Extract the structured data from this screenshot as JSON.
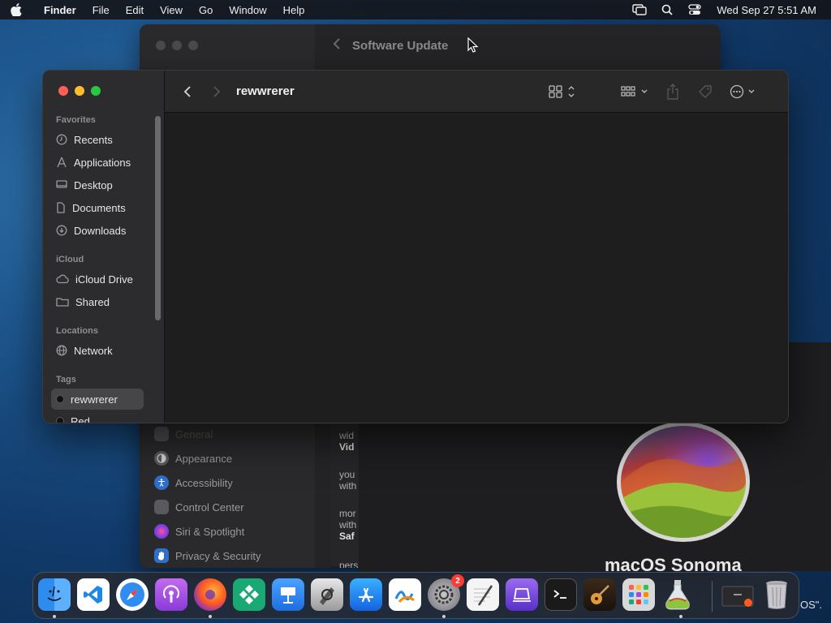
{
  "menubar": {
    "app_name": "Finder",
    "menus": [
      "File",
      "Edit",
      "View",
      "Go",
      "Window",
      "Help"
    ],
    "clock": "Wed Sep 27  5:51 AM",
    "tray_icons": [
      "screen-mirroring-icon",
      "spotlight-search-icon",
      "control-center-icon"
    ]
  },
  "background_window": {
    "title": "Software Update",
    "sidebar_items": [
      {
        "label": "General",
        "icon": "gear-icon",
        "color": "#8e8e93"
      },
      {
        "label": "Appearance",
        "icon": "appearance-icon",
        "color": "#6e6e72"
      },
      {
        "label": "Accessibility",
        "icon": "accessibility-icon",
        "color": "#2f7bd8"
      },
      {
        "label": "Control Center",
        "icon": "control-center-icon",
        "color": "#6e6e72"
      },
      {
        "label": "Siri & Spotlight",
        "icon": "siri-icon",
        "color": "#c04bd8"
      },
      {
        "label": "Privacy & Security",
        "icon": "hand-icon",
        "color": "#2f7bd8"
      }
    ],
    "content_fragments": [
      {
        "line1": "wid",
        "line2": "Vid"
      },
      {
        "line1": "you",
        "line2": "with"
      },
      {
        "line1": "mor",
        "line2": "with",
        "line3": "Saf"
      },
      {
        "line1": "pers"
      }
    ],
    "sonoma_title": "macOS Sonoma",
    "sonoma_tail": "OS\"."
  },
  "finder": {
    "title": "rewwrerer",
    "sidebar": {
      "favorites_header": "Favorites",
      "favorites": [
        {
          "label": "Recents",
          "icon": "clock-icon"
        },
        {
          "label": "Applications",
          "icon": "applications-icon"
        },
        {
          "label": "Desktop",
          "icon": "desktop-icon"
        },
        {
          "label": "Documents",
          "icon": "document-icon"
        },
        {
          "label": "Downloads",
          "icon": "download-icon"
        }
      ],
      "icloud_header": "iCloud",
      "icloud": [
        {
          "label": "iCloud Drive",
          "icon": "cloud-icon"
        },
        {
          "label": "Shared",
          "icon": "shared-folder-icon"
        }
      ],
      "locations_header": "Locations",
      "locations": [
        {
          "label": "Network",
          "icon": "globe-icon"
        }
      ],
      "tags_header": "Tags",
      "tags": [
        {
          "label": "rewwrerer",
          "color": "#111111",
          "selected": true
        },
        {
          "label": "Red",
          "color": "#111111",
          "selected": false
        }
      ]
    },
    "toolbar_icons": [
      "back-chevron-icon",
      "forward-chevron-icon",
      "view-grid-icon",
      "group-icon",
      "share-icon",
      "tag-icon",
      "more-actions-icon",
      "search-icon"
    ]
  },
  "dock": {
    "apps": [
      {
        "name": "Finder",
        "icon": "finder-icon",
        "color": "#2d8cf0",
        "running": true
      },
      {
        "name": "Visual Studio Code",
        "icon": "vscode-icon",
        "color": "#ffffff",
        "running": false
      },
      {
        "name": "Safari",
        "icon": "safari-icon",
        "color": "#ffffff",
        "running": false
      },
      {
        "name": "Podcasts",
        "icon": "podcasts-icon",
        "color": "#9b4de0",
        "running": false
      },
      {
        "name": "Firefox",
        "icon": "firefox-icon",
        "color": "#5b2ec9",
        "running": true
      },
      {
        "name": "Klack",
        "icon": "diamond-grid-icon",
        "color": "#19a974",
        "running": false
      },
      {
        "name": "Keynote",
        "icon": "keynote-icon",
        "color": "#2d8cf0",
        "running": false
      },
      {
        "name": "Script Editor",
        "icon": "script-editor-icon",
        "color": "#d0d0d0",
        "running": false
      },
      {
        "name": "App Store",
        "icon": "app-store-icon",
        "color": "#1e8cf0",
        "running": false
      },
      {
        "name": "Freeform",
        "icon": "freeform-icon",
        "color": "#ffffff",
        "running": false
      },
      {
        "name": "System Settings",
        "icon": "settings-gear-icon",
        "color": "#8e8e93",
        "running": true,
        "badge": "2"
      },
      {
        "name": "TextEdit",
        "icon": "textedit-icon",
        "color": "#f4f4f4",
        "running": false
      },
      {
        "name": "Simulator",
        "icon": "simulator-icon",
        "color": "#7a4de0",
        "running": false
      },
      {
        "name": "Terminal",
        "icon": "terminal-icon",
        "color": "#1a1a1a",
        "running": false
      },
      {
        "name": "GarageBand",
        "icon": "guitar-icon",
        "color": "#4a3a2a",
        "running": false
      },
      {
        "name": "Launchpad",
        "icon": "launchpad-icon",
        "color": "#d8d8d8",
        "running": false
      },
      {
        "name": "Sonoma Installer",
        "icon": "installer-flask-icon",
        "color": "#8cc63f",
        "running": true
      }
    ],
    "trailing": [
      {
        "name": "Downloads Stack",
        "icon": "downloads-stack-icon"
      },
      {
        "name": "Trash",
        "icon": "trash-icon"
      }
    ]
  }
}
